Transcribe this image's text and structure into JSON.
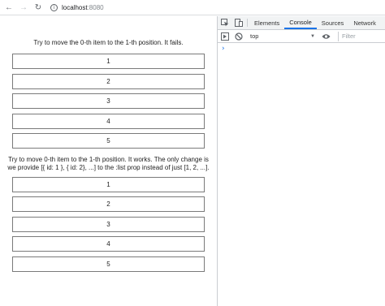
{
  "browser": {
    "back_icon": "←",
    "forward_icon": "→",
    "reload_icon": "↻",
    "info_icon": "i",
    "url_host": "localhost",
    "url_port": ":8080"
  },
  "page": {
    "heading1": "Try to move the 0-th item to the 1-th position. It fails.",
    "list1": [
      "1",
      "2",
      "3",
      "4",
      "5"
    ],
    "heading2_line1": "Try to move 0-th item to the 1-th position. It works. The only change is",
    "heading2_line2": "we provide [{ id: 1 }, { id: 2}, ...] to the :list prop instead of just [1, 2, ...].",
    "list2": [
      "1",
      "2",
      "3",
      "4",
      "5"
    ]
  },
  "devtools": {
    "tabs": [
      "Elements",
      "Console",
      "Sources",
      "Network"
    ],
    "active_tab": "Console",
    "context_value": "top",
    "filter_placeholder": "Filter",
    "prompt_symbol": "›",
    "accent_color": "#1a73e8"
  }
}
